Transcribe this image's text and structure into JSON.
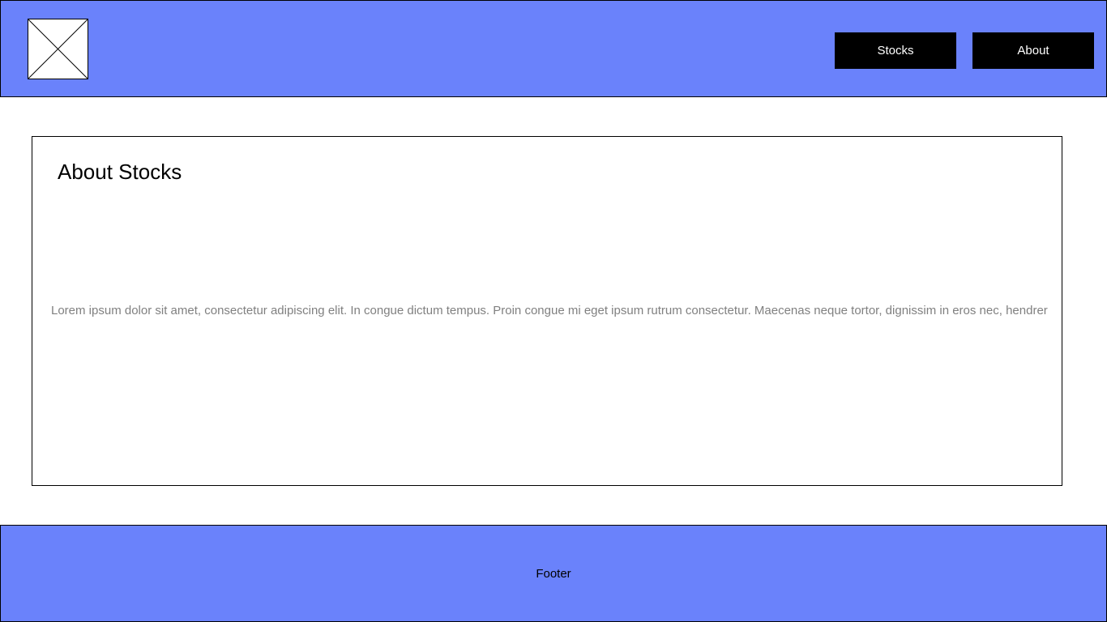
{
  "colors": {
    "header_bg": "#6a82fb",
    "footer_bg": "#6a82fb",
    "nav_button_bg": "#000000",
    "nav_button_text": "#ffffff",
    "body_text": "#808080"
  },
  "header": {
    "logo_icon": "image-placeholder-icon",
    "nav": {
      "stocks_label": "Stocks",
      "about_label": "About"
    }
  },
  "main": {
    "title": "About Stocks",
    "body": "Lorem ipsum dolor sit amet, consectetur adipiscing elit. In congue dictum tempus. Proin congue mi eget ipsum rutrum consectetur. Maecenas neque tortor, dignissim in eros nec, hendrer"
  },
  "footer": {
    "label": "Footer"
  }
}
